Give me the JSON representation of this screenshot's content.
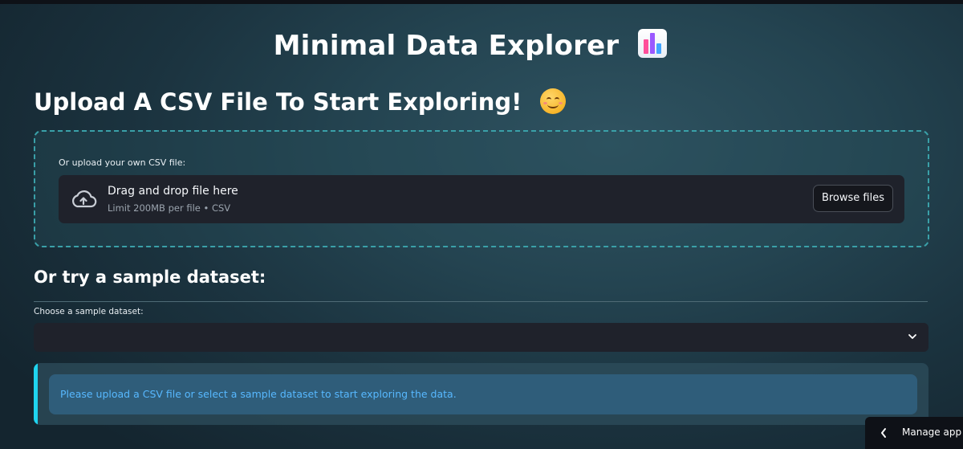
{
  "app": {
    "title": "Minimal Data Explorer",
    "title_emoji": "bar-chart-emoji"
  },
  "upload_section": {
    "heading": "Upload A CSV File To Start Exploring!",
    "heading_emoji": "smiling-face-emoji",
    "uploader_label": "Or upload your own CSV file:",
    "dropzone_title": "Drag and drop file here",
    "dropzone_subtitle": "Limit 200MB per file • CSV",
    "browse_button": "Browse files",
    "icon": "cloud-upload-icon"
  },
  "sample_section": {
    "heading": "Or try a sample dataset:",
    "select_label": "Choose a sample dataset:",
    "select_value": "",
    "icon": "chevron-down-icon"
  },
  "info_alert": {
    "message": "Please upload a CSV file or select a sample dataset to start exploring the data."
  },
  "footer": {
    "manage_app": "Manage app",
    "icon": "chevron-left-icon"
  },
  "colors": {
    "accent_cyan": "#1fd4ef",
    "info_text": "#57b8ff",
    "dark_panel": "#1f222b",
    "dashed_border": "#3aa0a8"
  }
}
